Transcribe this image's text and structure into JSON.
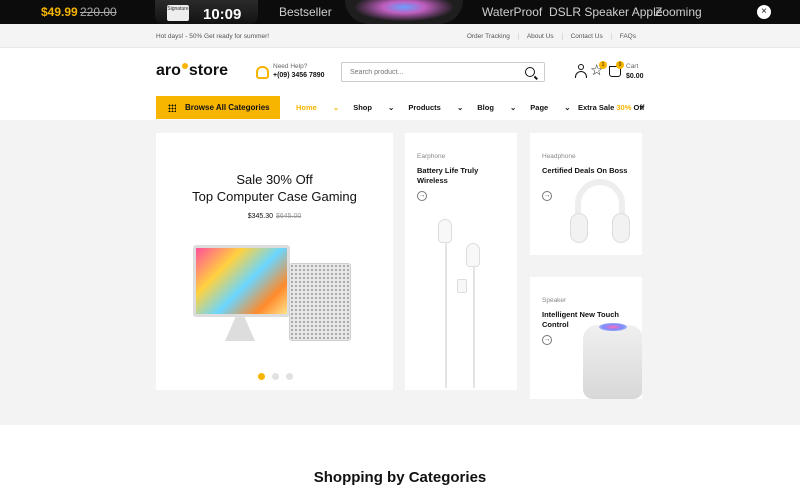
{
  "promo": {
    "price": "$49.99",
    "old_price": "220.00",
    "watch_time": "10:09",
    "watch_tag": "Signature",
    "keywords": [
      "Bestseller",
      "WaterProof",
      "DSLR Speaker Apple",
      "Zooming"
    ],
    "close": "×"
  },
  "notice": {
    "message": "Hot days! - 50% Get ready for summer!",
    "links": [
      "Order Tracking",
      "About Us",
      "Contact Us",
      "FAQs"
    ]
  },
  "header": {
    "logo_left": "aro",
    "logo_right": "store",
    "help_label": "Need Help?",
    "help_phone": "+(09) 3456 7890",
    "search_placeholder": "Search product...",
    "wishlist_count": "1",
    "cart_count": "0",
    "cart_label": "Cart",
    "cart_total": "$0.00"
  },
  "nav": {
    "categories_button": "Browse All Categories",
    "items": [
      "Home",
      "Shop",
      "Products",
      "Blog",
      "Page"
    ],
    "extra_sale_prefix": "Extra Sale",
    "extra_sale_percent": "30%",
    "extra_sale_suffix": "Off",
    "extra_arrow": "›"
  },
  "hero": {
    "title_line1": "Sale 30% Off",
    "title_line2": "Top Computer Case Gaming",
    "price": "$345.30",
    "old_price": "$645.00"
  },
  "cards": {
    "earphone": {
      "category": "Earphone",
      "title": "Battery Life Truly Wireless",
      "arrow": "→"
    },
    "headphone": {
      "category": "Headphone",
      "title": "Certified Deals On Boss",
      "arrow": "→"
    },
    "speaker": {
      "category": "Speaker",
      "title": "Intelligent New Touch Control",
      "arrow": "→"
    }
  },
  "section": {
    "title": "Shopping by Categories"
  },
  "colors": {
    "accent": "#f7b500",
    "dark": "#0c0c0c"
  }
}
